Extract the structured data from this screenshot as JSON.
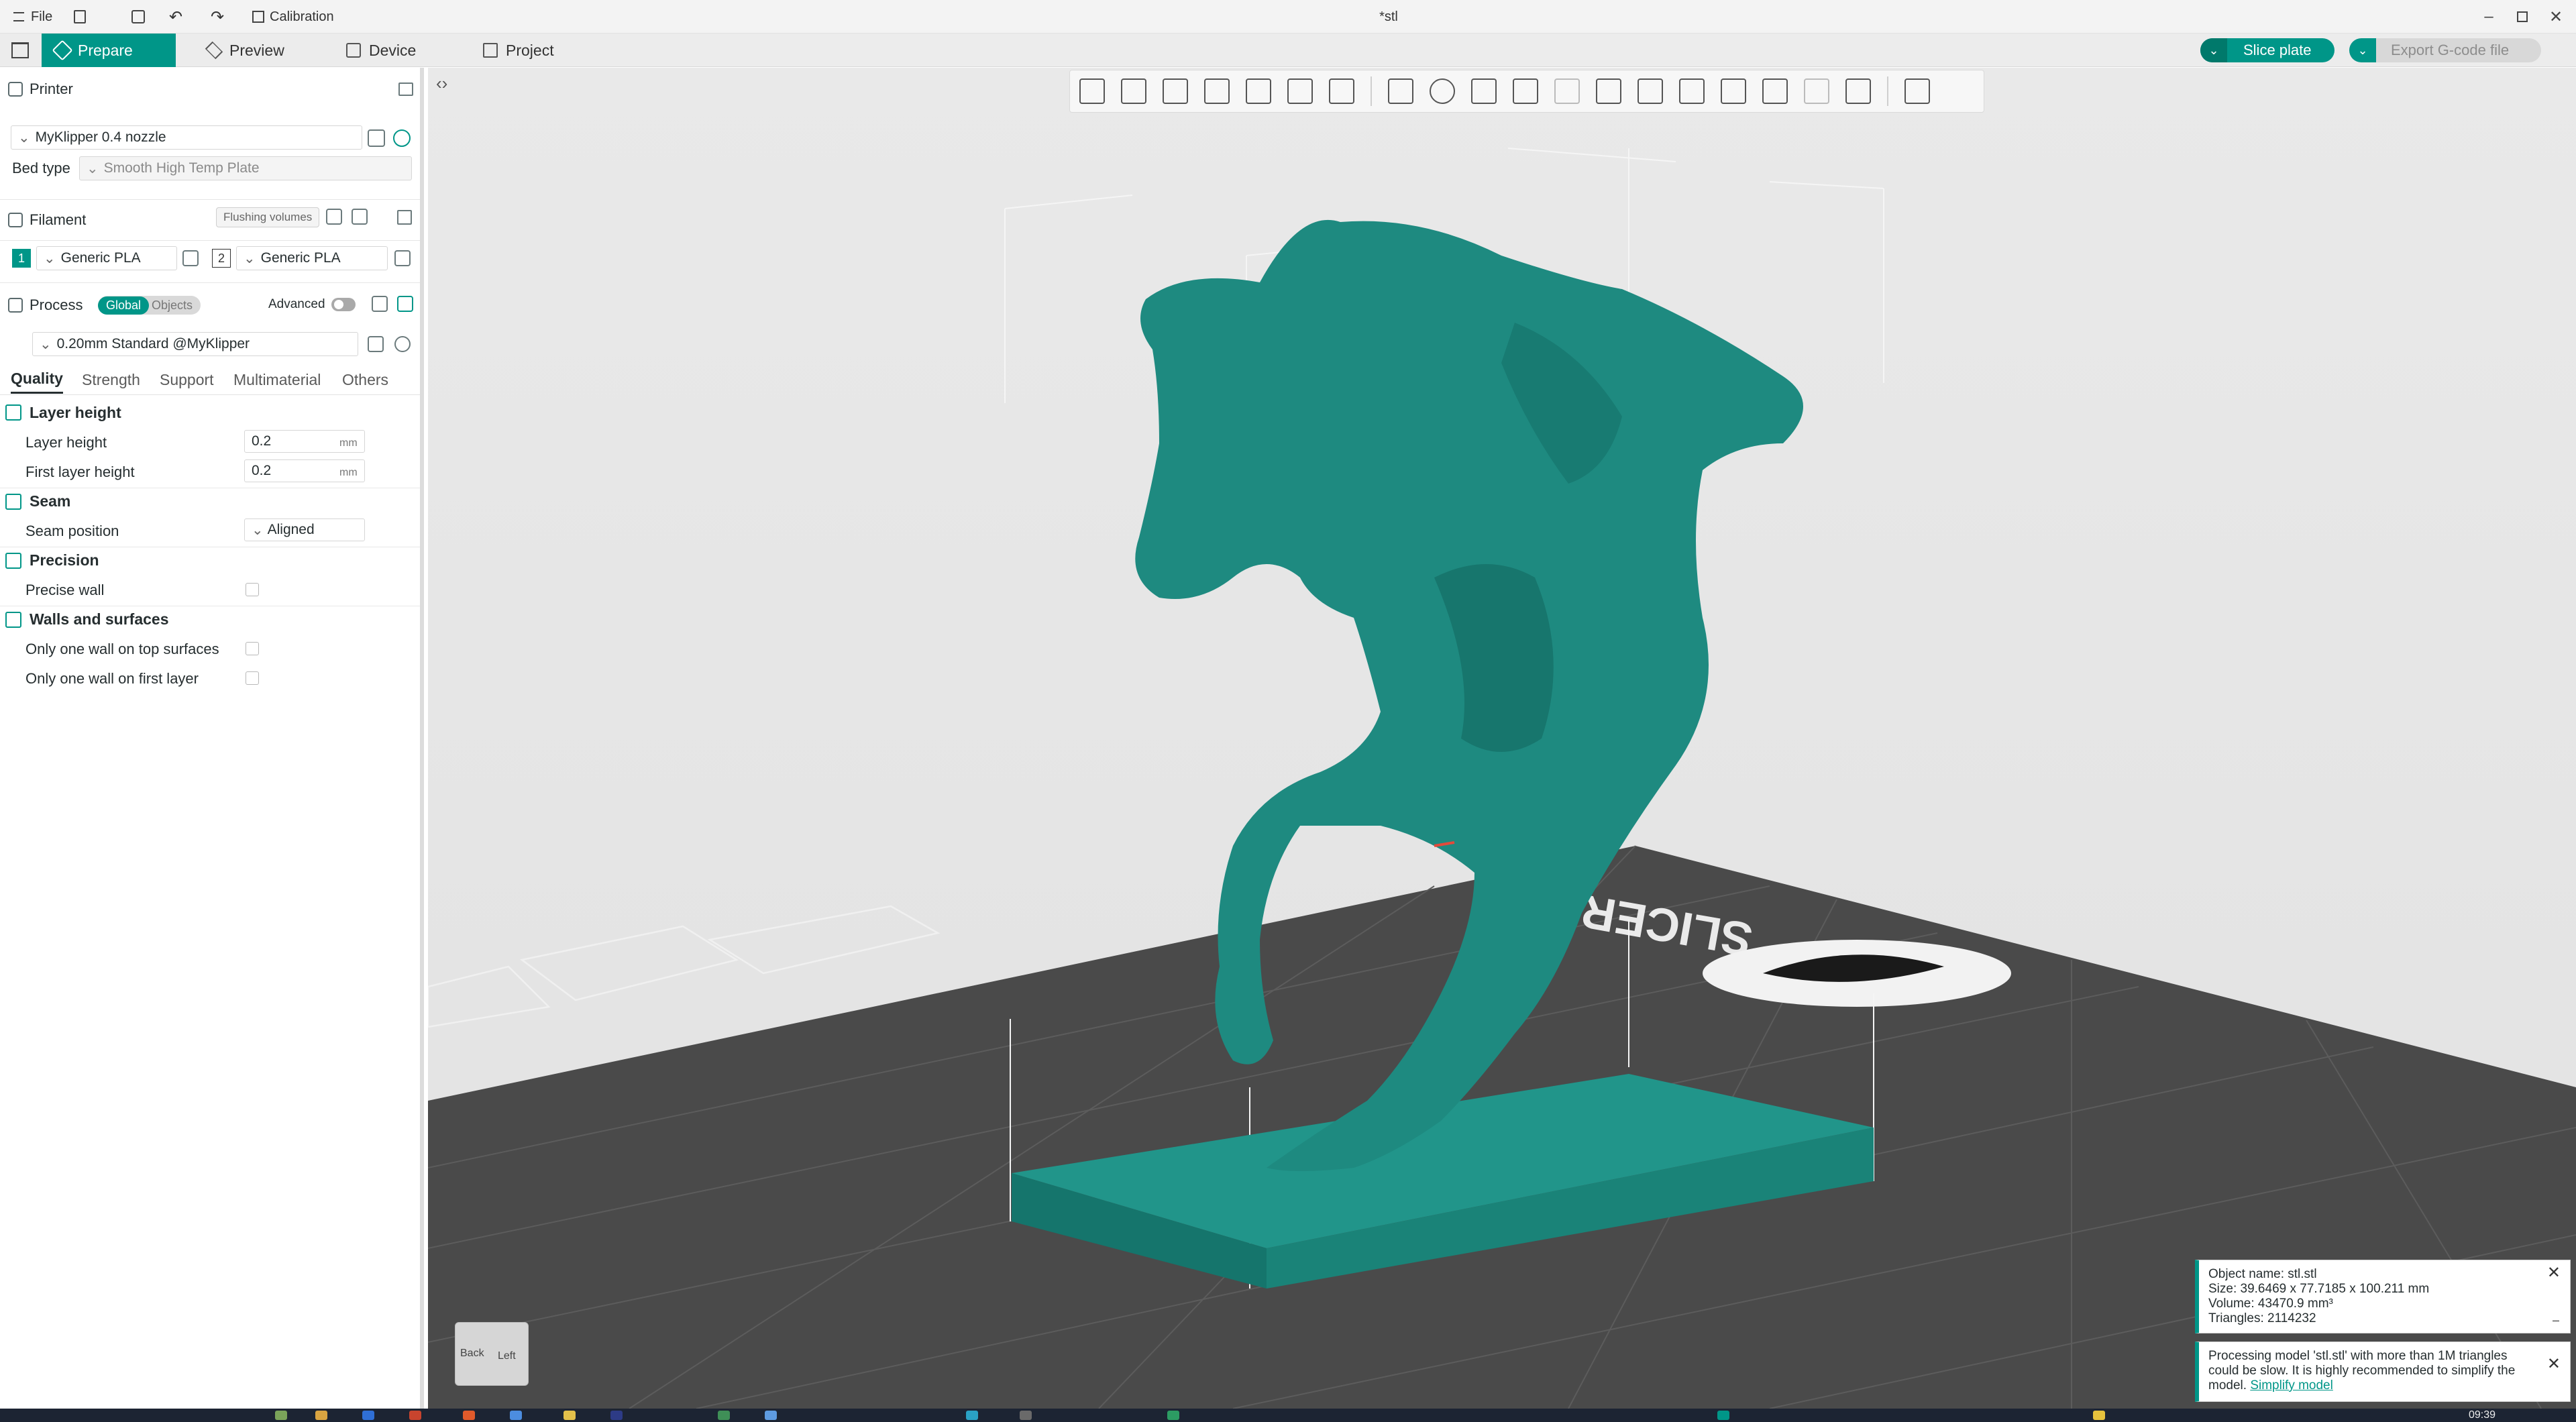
{
  "titlebar": {
    "file_label": "File",
    "calibration_label": "Calibration",
    "window_title": "*stl"
  },
  "tabs": [
    {
      "label": "Prepare",
      "active": true
    },
    {
      "label": "Preview",
      "active": false
    },
    {
      "label": "Device",
      "active": false
    },
    {
      "label": "Project",
      "active": false
    }
  ],
  "actions": {
    "slice_label": "Slice plate",
    "export_label": "Export G-code file"
  },
  "printer": {
    "section_label": "Printer",
    "printer_name": "MyKlipper 0.4 nozzle",
    "bed_type_label": "Bed type",
    "bed_type_value": "Smooth High Temp Plate"
  },
  "filament": {
    "section_label": "Filament",
    "flushing_label": "Flushing volumes",
    "slots": [
      {
        "index": "1",
        "name": "Generic PLA",
        "color": "#009688"
      },
      {
        "index": "2",
        "name": "Generic PLA",
        "color": "#ffffff"
      }
    ]
  },
  "process": {
    "section_label": "Process",
    "global_label": "Global",
    "objects_label": "Objects",
    "advanced_label": "Advanced",
    "preset": "0.20mm Standard @MyKlipper",
    "tabs": [
      "Quality",
      "Strength",
      "Support",
      "Multimaterial",
      "Others"
    ],
    "groups": {
      "layer_height": {
        "title": "Layer height",
        "layer_height_label": "Layer height",
        "layer_height_value": "0.2",
        "first_layer_label": "First layer height",
        "first_layer_value": "0.2",
        "unit": "mm"
      },
      "seam": {
        "title": "Seam",
        "seam_position_label": "Seam position",
        "seam_position_value": "Aligned"
      },
      "precision": {
        "title": "Precision",
        "precise_wall_label": "Precise wall"
      },
      "walls": {
        "title": "Walls and surfaces",
        "one_wall_top_label": "Only one wall on top surfaces",
        "one_wall_first_label": "Only one wall on first layer"
      }
    }
  },
  "viewport": {
    "plate_text": "SLICER",
    "model_color": "#1e8a80",
    "bed_color": "#4a4a4a",
    "nav_cube": {
      "back": "Back",
      "left": "Left"
    }
  },
  "notifications": {
    "object_info": {
      "name": "Object name: stl.stl",
      "size": "Size: 39.6469 x 77.7185 x 100.211 mm",
      "volume": "Volume: 43470.9 mm³",
      "triangles": "Triangles: 2114232"
    },
    "processing": {
      "text": "Processing model 'stl.stl' with more than 1M triangles could be slow. It is highly recommended to simplify the model.",
      "link": "Simplify model"
    }
  },
  "taskbar": {
    "time": "09:39"
  }
}
